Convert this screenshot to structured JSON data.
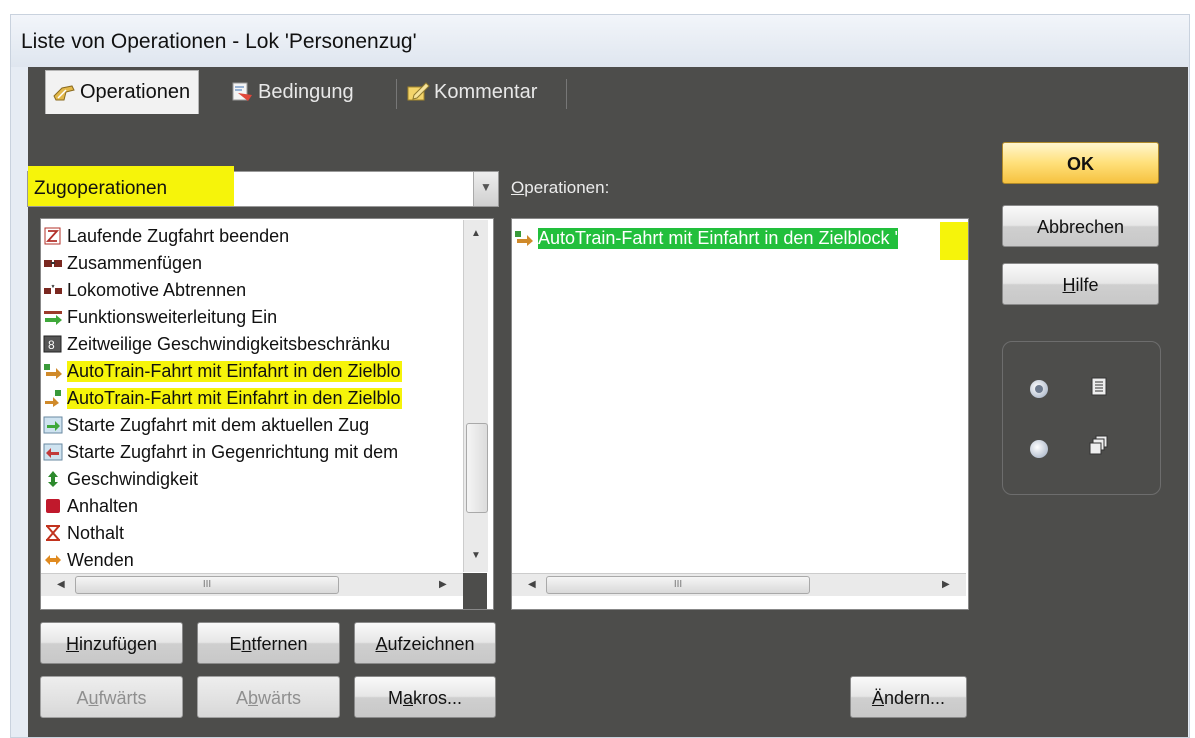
{
  "window": {
    "title": "Liste von Operationen - Lok 'Personenzug'"
  },
  "tabs": [
    {
      "label": "Operationen",
      "icon": "hand-pointer-icon"
    },
    {
      "label": "Bedingung",
      "icon": "condition-icon"
    },
    {
      "label": "Kommentar",
      "icon": "pencil-note-icon"
    }
  ],
  "category_select": {
    "value": "Zugoperationen"
  },
  "operations_label": {
    "prefix": "O",
    "rest": "perationen:"
  },
  "left_list": {
    "items": [
      {
        "label": "Laufende Zugfahrt beenden",
        "icon": "stop-train-icon"
      },
      {
        "label": "Zusammenfügen",
        "icon": "couple-train-icon"
      },
      {
        "label": "Lokomotive Abtrennen",
        "icon": "uncouple-loco-icon"
      },
      {
        "label": "Funktionsweiterleitung Ein",
        "icon": "function-forward-icon"
      },
      {
        "label": "Zeitweilige Geschwindigkeitsbeschränku",
        "icon": "speed-limit-icon"
      },
      {
        "label": "AutoTrain-Fahrt mit Einfahrt in den Zielblo",
        "icon": "autotrain-icon"
      },
      {
        "label": "AutoTrain-Fahrt mit Einfahrt in den Zielblo",
        "icon": "autotrain-alt-icon"
      },
      {
        "label": "Starte Zugfahrt mit dem aktuellen Zug",
        "icon": "start-train-icon"
      },
      {
        "label": "Starte Zugfahrt in Gegenrichtung mit dem",
        "icon": "start-train-reverse-icon"
      },
      {
        "label": "Geschwindigkeit",
        "icon": "speed-icon"
      },
      {
        "label": "Anhalten",
        "icon": "stop-icon"
      },
      {
        "label": "Nothalt",
        "icon": "emergency-stop-icon"
      },
      {
        "label": "Wenden",
        "icon": "reverse-direction-icon"
      }
    ]
  },
  "right_list": {
    "items": [
      {
        "label": "AutoTrain-Fahrt mit Einfahrt in den Zielblock '",
        "icon": "autotrain-icon"
      }
    ]
  },
  "buttons": {
    "ok": "OK",
    "cancel": "Abbrechen",
    "help": {
      "pre": "",
      "accel": "H",
      "post": "ilfe"
    },
    "add": {
      "pre": "",
      "accel": "H",
      "post": "inzufügen"
    },
    "remove": {
      "pre": "E",
      "accel": "n",
      "post": "tfernen"
    },
    "record": {
      "pre": "",
      "accel": "A",
      "post": "ufzeichnen"
    },
    "up": {
      "pre": "A",
      "accel": "u",
      "post": "fwärts"
    },
    "down": {
      "pre": "A",
      "accel": "b",
      "post": "wärts"
    },
    "macros": {
      "pre": "M",
      "accel": "a",
      "post": "kros..."
    },
    "change": {
      "pre": "",
      "accel": "Ä",
      "post": "ndern..."
    }
  },
  "scroll": {
    "grip": "III"
  },
  "colors": {
    "highlight": "#f6f40a",
    "selection": "#22bf3c",
    "dialog_bg": "#4d4d4b",
    "ok_button": "#ffe07a"
  }
}
